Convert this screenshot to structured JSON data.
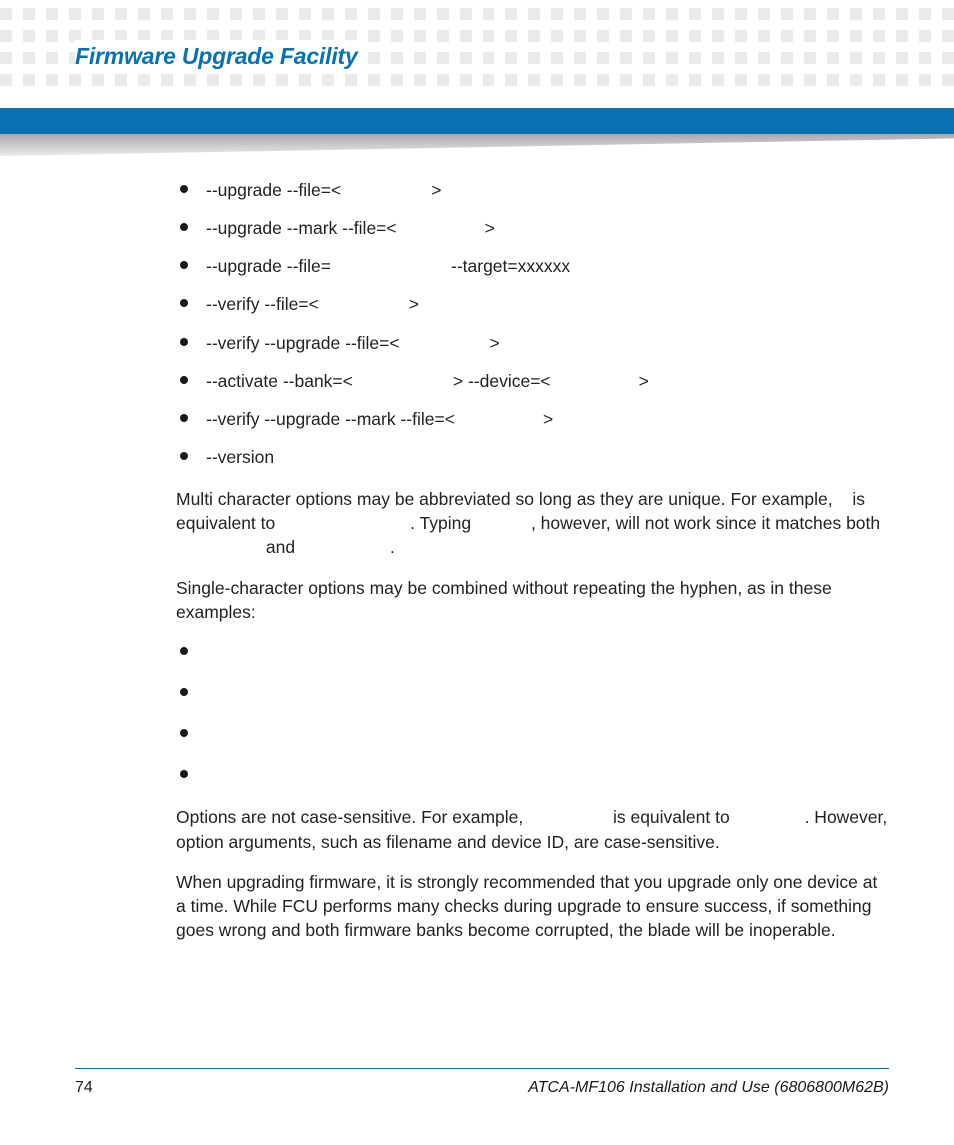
{
  "header": {
    "title": "Firmware Upgrade Facility"
  },
  "options": [
    {
      "pre": "--upgrade --file=<",
      "mid": "",
      "post": ">"
    },
    {
      "pre": "--upgrade --mark --file=<",
      "mid": "",
      "post": ">"
    },
    {
      "pre": "--upgrade --file=",
      "mid": "",
      "post": "--target=xxxxxx"
    },
    {
      "pre": "--verify --file=<",
      "mid": "",
      "post": ">"
    },
    {
      "pre": "--verify --upgrade --file=<",
      "mid": "",
      "post": ">"
    },
    {
      "pre": "--activate --bank=<",
      "mid": "",
      "post": "> --device=<",
      "mid2": "",
      "post2": ">"
    },
    {
      "pre": "--verify --upgrade --mark --file=<",
      "mid": "",
      "post": ">"
    },
    {
      "pre": "--version"
    }
  ],
  "para1": {
    "t1": "Multi character options may be abbreviated so long as they are unique. For example, ",
    "t2": " is equivalent to ",
    "t3": ". Typing ",
    "t4": ", however, will not work since it matches both ",
    "t5": " and ",
    "t6": "."
  },
  "para2": "Single-character options may be combined without repeating the hyphen, as in these examples:",
  "sublist_count": 4,
  "para3": {
    "t1": "Options are not case-sensitive. For example, ",
    "t2": " is equivalent to ",
    "t3": ". However, option arguments, such as filename and device ID, are case-sensitive."
  },
  "para4": "When upgrading firmware, it is strongly recommended that you upgrade only one device at a time. While FCU performs many checks during upgrade to ensure success, if something goes wrong and both firmware banks become corrupted, the blade will be inoperable.",
  "footer": {
    "page": "74",
    "doc": "ATCA-MF106 Installation and Use (6806800M62B)"
  }
}
